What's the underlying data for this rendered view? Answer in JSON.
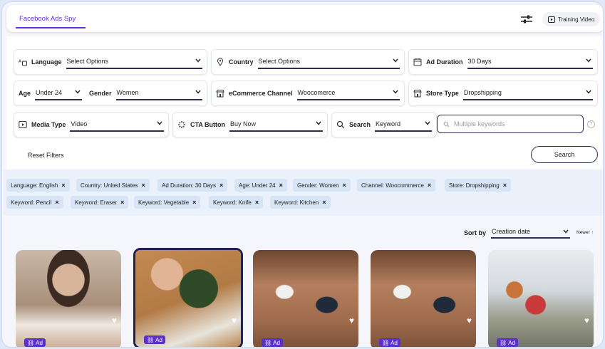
{
  "header": {
    "active_tab": "Facebook Ads Spy",
    "training_label": "Training Video"
  },
  "filters": {
    "language": {
      "label": "Language",
      "value": "Select Options"
    },
    "country": {
      "label": "Country",
      "value": "Select Options"
    },
    "ad_duration": {
      "label": "Ad Duration",
      "value": "30 Days"
    },
    "age": {
      "label": "Age",
      "value": "Under 24"
    },
    "gender": {
      "label": "Gender",
      "value": "Women"
    },
    "ecommerce_channel": {
      "label": "eCommerce Channel",
      "value": "Woocomerce"
    },
    "store_type": {
      "label": "Store Type",
      "value": "Dropshipping"
    },
    "media_type": {
      "label": "Media Type",
      "value": "Video"
    },
    "cta_button": {
      "label": "CTA Button",
      "value": "Buy Now"
    },
    "search": {
      "label": "Search",
      "value": "Keyword",
      "placeholder": "Multiple keywords"
    }
  },
  "actions": {
    "reset": "Reset Filters",
    "search": "Search"
  },
  "tags": [
    "Language: English",
    "Country: United States",
    "Ad Duration: 30 Days",
    "Age: Under 24",
    "Gender: Women",
    "Channel: Woocommerce",
    "Store: Dropshipping",
    "Keyword: Pencil",
    "Keyword: Eraser",
    "Keyword: Vegetable",
    "Keyword: Knife",
    "Keyword: Kitchen"
  ],
  "sort": {
    "label": "Sort by",
    "value": "Creation date",
    "order": "Newer ↑"
  },
  "cards": [
    {
      "badge": "Ad"
    },
    {
      "badge": "Ad"
    },
    {
      "badge": "Ad"
    },
    {
      "badge": "Ad"
    },
    {
      "badge": "Ad"
    }
  ],
  "colors": {
    "accent": "#6a2bd9",
    "navy": "#2c2d55",
    "badge": "#5b2fc9",
    "tag_bg": "#d7e4f6"
  },
  "icons": [
    "sliders-icon",
    "video-icon",
    "translate-icon",
    "location-pin-icon",
    "calendar-icon",
    "store-icon",
    "play-icon",
    "spinner-icon",
    "search-icon",
    "chevron-down-icon",
    "close-icon",
    "heart-icon",
    "link-icon",
    "help-icon"
  ]
}
